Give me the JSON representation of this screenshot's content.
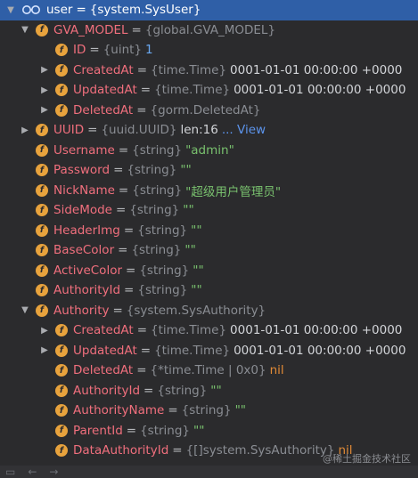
{
  "rows": [
    {
      "name": "user",
      "eq": "=",
      "type": "{system.SysUser}",
      "expanded": true,
      "selected": true,
      "icon": "glasses-icon"
    },
    {
      "name": "GVA_MODEL",
      "eq": "=",
      "type": "{global.GVA_MODEL}",
      "expanded": true
    },
    {
      "name": "ID",
      "eq": "=",
      "type": "{uint}",
      "value": "1",
      "value_kind": "num"
    },
    {
      "name": "CreatedAt",
      "eq": "=",
      "type": "{time.Time}",
      "value": "0001-01-01 00:00:00 +0000",
      "value_kind": "val",
      "collapsed": true
    },
    {
      "name": "UpdatedAt",
      "eq": "=",
      "type": "{time.Time}",
      "value": "0001-01-01 00:00:00 +0000",
      "value_kind": "val",
      "collapsed": true
    },
    {
      "name": "DeletedAt",
      "eq": "=",
      "type": "{gorm.DeletedAt}",
      "collapsed": true
    },
    {
      "name": "UUID",
      "eq": "=",
      "type": "{uuid.UUID}",
      "value": "len:16",
      "value_kind": "val",
      "extra": "... View",
      "collapsed": true
    },
    {
      "name": "Username",
      "eq": "=",
      "type": "{string}",
      "value": "\"admin\"",
      "value_kind": "str"
    },
    {
      "name": "Password",
      "eq": "=",
      "type": "{string}",
      "value": "\"\"",
      "value_kind": "str"
    },
    {
      "name": "NickName",
      "eq": "=",
      "type": "{string}",
      "value": "\"超级用户管理员\"",
      "value_kind": "str"
    },
    {
      "name": "SideMode",
      "eq": "=",
      "type": "{string}",
      "value": "\"\"",
      "value_kind": "str"
    },
    {
      "name": "HeaderImg",
      "eq": "=",
      "type": "{string}",
      "value": "\"\"",
      "value_kind": "str"
    },
    {
      "name": "BaseColor",
      "eq": "=",
      "type": "{string}",
      "value": "\"\"",
      "value_kind": "str"
    },
    {
      "name": "ActiveColor",
      "eq": "=",
      "type": "{string}",
      "value": "\"\"",
      "value_kind": "str"
    },
    {
      "name": "AuthorityId",
      "eq": "=",
      "type": "{string}",
      "value": "\"\"",
      "value_kind": "str"
    },
    {
      "name": "Authority",
      "eq": "=",
      "type": "{system.SysAuthority}",
      "expanded": true
    },
    {
      "name": "CreatedAt",
      "eq": "=",
      "type": "{time.Time}",
      "value": "0001-01-01 00:00:00 +0000",
      "value_kind": "val",
      "collapsed": true
    },
    {
      "name": "UpdatedAt",
      "eq": "=",
      "type": "{time.Time}",
      "value": "0001-01-01 00:00:00 +0000",
      "value_kind": "val",
      "collapsed": true
    },
    {
      "name": "DeletedAt",
      "eq": "=",
      "type": "{*time.Time | 0x0}",
      "value": "nil",
      "value_kind": "nil"
    },
    {
      "name": "AuthorityId",
      "eq": "=",
      "type": "{string}",
      "value": "\"\"",
      "value_kind": "str"
    },
    {
      "name": "AuthorityName",
      "eq": "=",
      "type": "{string}",
      "value": "\"\"",
      "value_kind": "str"
    },
    {
      "name": "ParentId",
      "eq": "=",
      "type": "{string}",
      "value": "\"\"",
      "value_kind": "str"
    },
    {
      "name": "DataAuthorityId",
      "eq": "=",
      "type": "{[]system.SysAuthority}",
      "value": "nil",
      "value_kind": "nil"
    }
  ],
  "watermark": "@稀土掘金技术社区",
  "colors": {
    "background": "#2b2b2d",
    "selected": "#2f5fa7",
    "field_name": "#f06f7d",
    "string": "#79c16e",
    "number": "#6aa9f2",
    "nil": "#e08a36",
    "badge": "#e8a33d"
  }
}
